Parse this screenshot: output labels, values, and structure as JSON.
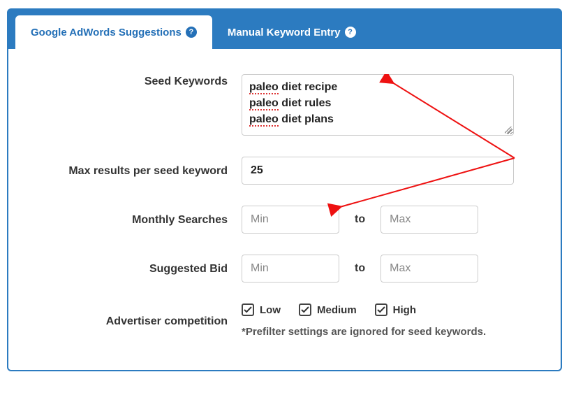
{
  "tabs": {
    "active": "Google AdWords Suggestions",
    "inactive": "Manual Keyword Entry"
  },
  "form": {
    "seed_label": "Seed Keywords",
    "seed_lines": [
      {
        "spell": "paleo",
        "rest": " diet recipe"
      },
      {
        "spell": "paleo",
        "rest": " diet rules"
      },
      {
        "spell": "paleo",
        "rest": " diet plans"
      }
    ],
    "max_label": "Max results per seed keyword",
    "max_value": "25",
    "monthly_label": "Monthly Searches",
    "bid_label": "Suggested Bid",
    "min_ph": "Min",
    "max_ph": "Max",
    "range_sep": "to",
    "comp_label": "Advertiser competition",
    "comp_low": "Low",
    "comp_medium": "Medium",
    "comp_high": "High",
    "note": "*Prefilter settings are ignored for seed keywords."
  }
}
